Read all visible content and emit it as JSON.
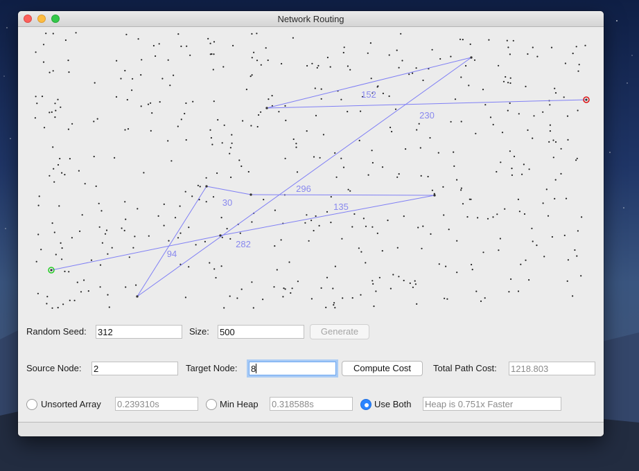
{
  "window": {
    "title": "Network Routing"
  },
  "controls": {
    "seed_label": "Random Seed:",
    "seed_value": "312",
    "size_label": "Size:",
    "size_value": "500",
    "generate_label": "Generate",
    "source_label": "Source Node:",
    "source_value": "2",
    "target_label": "Target Node:",
    "target_value": "8",
    "compute_label": "Compute Cost",
    "total_label": "Total Path Cost:",
    "total_value": "1218.803",
    "unsorted_label": "Unsorted Array",
    "unsorted_time": "0.239310s",
    "heap_label": "Min Heap",
    "heap_time": "0.318588s",
    "both_label": "Use Both",
    "comparison": "Heap is 0.751x Faster",
    "selected_mode": "Use Both"
  },
  "graph": {
    "edge_color": "#7f7ff5",
    "edge_label_color": "#8888ee",
    "source_marker_color": "#22cc22",
    "target_marker_color": "#dd1111",
    "edge_labels": [
      "152",
      "230",
      "296",
      "30",
      "135",
      "282",
      "94"
    ]
  }
}
